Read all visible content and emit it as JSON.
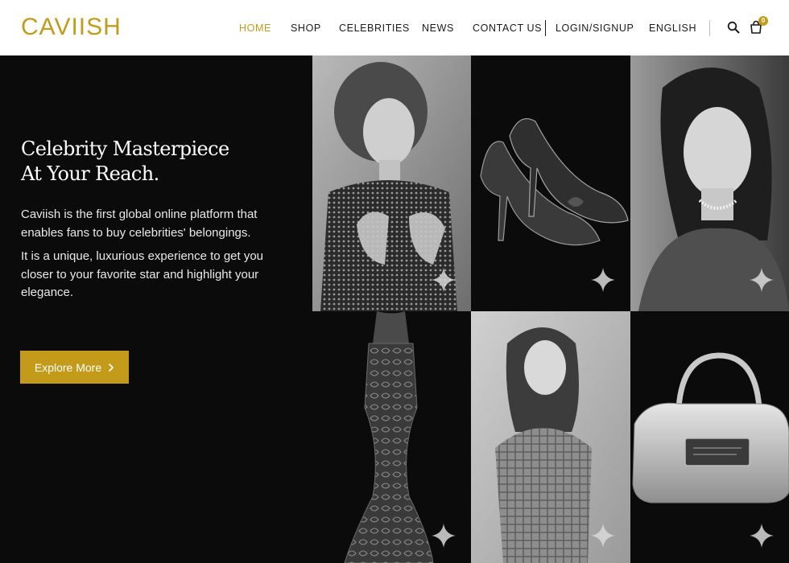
{
  "brand": {
    "logo_text": "CAVIISH",
    "accent_color": "#c39a19"
  },
  "nav": {
    "items": [
      {
        "label": "HOME",
        "active": true
      },
      {
        "label": "SHOP",
        "active": false
      },
      {
        "label": "CELEBRITIES",
        "active": false
      },
      {
        "label": "NEWS",
        "active": false
      },
      {
        "label": "CONTACT US",
        "active": false
      }
    ],
    "login_label": "LOGIN/SIGNUP",
    "language_label": "ENGLISH",
    "search_icon": "search-icon",
    "cart_icon": "shopping-bag-icon",
    "cart_count": "0"
  },
  "hero": {
    "title_line1": "Celebrity Masterpiece",
    "title_line2": "At Your Reach.",
    "paragraph1": "Caviish is the first global online platform that enables fans to buy celebrities' belongings.",
    "paragraph2": "It is a unique, luxurious experience to get you closer to your favorite star and highlight your elegance.",
    "cta_label": "Explore More",
    "cta_icon": "chevron-right-icon"
  },
  "gallery": {
    "tiles": [
      {
        "name": "celebrity-photo-1",
        "kind": "celebrity"
      },
      {
        "name": "product-shoes",
        "kind": "product"
      },
      {
        "name": "celebrity-photo-2",
        "kind": "celebrity"
      },
      {
        "name": "product-dress",
        "kind": "product"
      },
      {
        "name": "celebrity-photo-3",
        "kind": "celebrity"
      },
      {
        "name": "product-handbag",
        "kind": "product"
      }
    ],
    "sparkle_icon": "sparkle-icon"
  }
}
